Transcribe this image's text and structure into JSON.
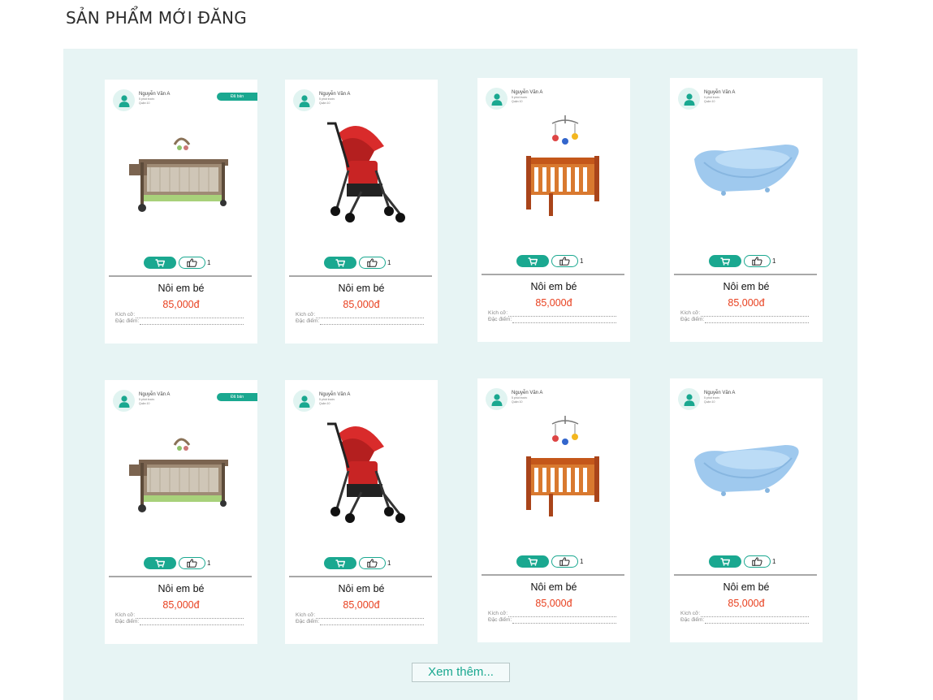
{
  "section": {
    "title": "SẢN PHẨM MỚI ĐĂNG"
  },
  "more_button": "Xem thêm...",
  "products": [
    {
      "seller_name": "Nguyễn Văn A",
      "posted": "5 phút trước",
      "location": "Quận 10",
      "sold_label": "Đã bán",
      "image": "playpen",
      "like_count": "1",
      "name": "Nôi em bé",
      "price": "85,000đ",
      "size_label": "Kích cỡ:",
      "features_label": "Đặc điểm:"
    },
    {
      "seller_name": "Nguyễn Văn A",
      "posted": "5 phút trước",
      "location": "Quận 10",
      "sold_label": "",
      "image": "stroller",
      "like_count": "1",
      "name": "Nôi em bé",
      "price": "85,000đ",
      "size_label": "Kích cỡ:",
      "features_label": "Đặc điểm:"
    },
    {
      "seller_name": "Nguyễn Văn A",
      "posted": "5 phút trước",
      "location": "Quận 10",
      "sold_label": "",
      "image": "crib",
      "like_count": "1",
      "name": "Nôi em bé",
      "price": "85,000đ",
      "size_label": "Kích cỡ:",
      "features_label": "Đặc điểm:"
    },
    {
      "seller_name": "Nguyễn Văn A",
      "posted": "5 phút trước",
      "location": "Quận 10",
      "sold_label": "",
      "image": "bathtub",
      "like_count": "1",
      "name": "Nôi em bé",
      "price": "85,000đ",
      "size_label": "Kích cỡ:",
      "features_label": "Đặc điểm:"
    },
    {
      "seller_name": "Nguyễn Văn A",
      "posted": "5 phút trước",
      "location": "Quận 10",
      "sold_label": "Đã bán",
      "image": "playpen",
      "like_count": "1",
      "name": "Nôi em bé",
      "price": "85,000đ",
      "size_label": "Kích cỡ:",
      "features_label": "Đặc điểm:"
    },
    {
      "seller_name": "Nguyễn Văn A",
      "posted": "5 phút trước",
      "location": "Quận 10",
      "sold_label": "",
      "image": "stroller",
      "like_count": "1",
      "name": "Nôi em bé",
      "price": "85,000đ",
      "size_label": "Kích cỡ:",
      "features_label": "Đặc điểm:"
    },
    {
      "seller_name": "Nguyễn Văn A",
      "posted": "5 phút trước",
      "location": "Quận 10",
      "sold_label": "",
      "image": "crib",
      "like_count": "1",
      "name": "Nôi em bé",
      "price": "85,000đ",
      "size_label": "Kích cỡ:",
      "features_label": "Đặc điểm:"
    },
    {
      "seller_name": "Nguyễn Văn A",
      "posted": "5 phút trước",
      "location": "Quận 10",
      "sold_label": "",
      "image": "bathtub",
      "like_count": "1",
      "name": "Nôi em bé",
      "price": "85,000đ",
      "size_label": "Kích cỡ:",
      "features_label": "Đặc điểm:"
    }
  ],
  "colors": {
    "accent": "#1aa890",
    "price": "#e8401f",
    "panel": "#e7f4f4"
  },
  "icons": {
    "avatar": "user-icon",
    "cart": "cart-icon",
    "like": "thumbs-up-icon"
  }
}
